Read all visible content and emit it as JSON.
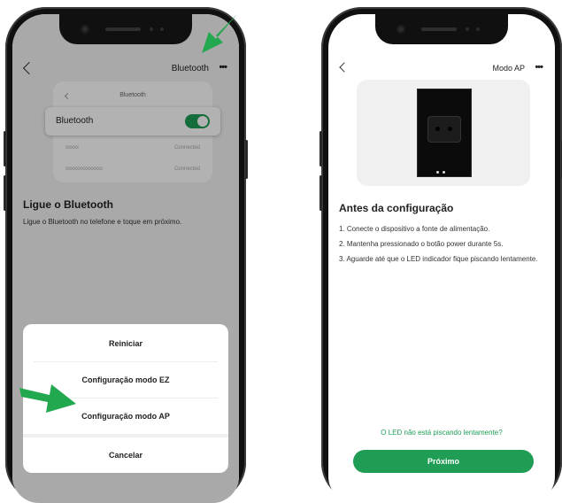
{
  "left": {
    "header_title": "Bluetooth",
    "menu_dots": "•••",
    "card": {
      "title": "Bluetooth",
      "toggle_label": "Bluetooth",
      "toggle_on": true,
      "devices": [
        {
          "name": "xxxxx",
          "status": "Connected"
        },
        {
          "name": "xxxxxxxxxxxxxx",
          "status": "Connected"
        }
      ]
    },
    "heading": "Ligue o Bluetooth",
    "description": "Ligue o Bluetooth no telefone e toque em próximo.",
    "sheet": {
      "options": [
        "Reiniciar",
        "Configuração modo EZ",
        "Configuração modo AP"
      ],
      "cancel": "Cancelar"
    }
  },
  "right": {
    "header_title": "Modo AP",
    "menu_dots": "•••",
    "heading": "Antes da configuração",
    "steps": [
      "1. Conecte o dispositivo a fonte de alimentação.",
      "2. Mantenha pressionado o botão power durante 5s.",
      "3. Aguarde até que o LED indicador fique piscando lentamente."
    ],
    "link": "O LED não está piscando lentamente?",
    "next_button": "Próximo"
  },
  "colors": {
    "accent_green": "#1f9d55",
    "arrow_green": "#22a84f"
  },
  "icons": [
    "back-chevron-icon",
    "more-dots-icon",
    "toggle-switch-icon",
    "pointer-arrow-icon"
  ]
}
